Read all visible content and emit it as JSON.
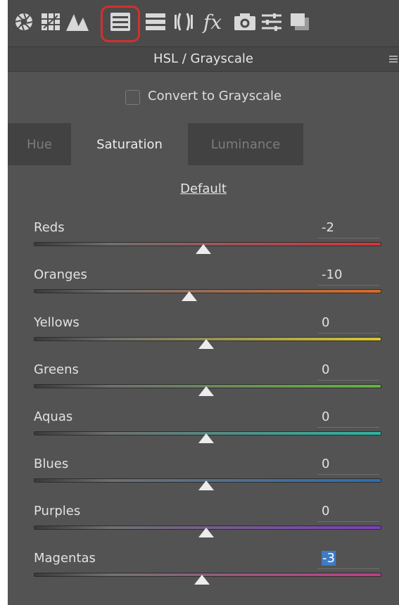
{
  "toolbar": {
    "icons": [
      "aperture-icon",
      "grid-icon",
      "mountain-icon",
      "hsl-icon",
      "split-toning-icon",
      "lens-icon",
      "fx-icon",
      "camera-icon",
      "presets-icon",
      "snapshots-icon"
    ],
    "fx_label": "fx",
    "active_icon": "hsl-icon"
  },
  "panel": {
    "title": "HSL / Grayscale"
  },
  "convert": {
    "label": "Convert to Grayscale",
    "checked": false
  },
  "tabs": [
    {
      "label": "Hue",
      "active": false
    },
    {
      "label": "Saturation",
      "active": true
    },
    {
      "label": "Luminance",
      "active": false
    }
  ],
  "default_link": "Default",
  "sliders": [
    {
      "label": "Reds",
      "value": "-2",
      "color": "#d6333a"
    },
    {
      "label": "Oranges",
      "value": "-10",
      "color": "#d86a2a"
    },
    {
      "label": "Yellows",
      "value": "0",
      "color": "#d7c82c"
    },
    {
      "label": "Greens",
      "value": "0",
      "color": "#62b33c"
    },
    {
      "label": "Aquas",
      "value": "0",
      "color": "#2fb3a0"
    },
    {
      "label": "Blues",
      "value": "0",
      "color": "#2a6fb6"
    },
    {
      "label": "Purples",
      "value": "0",
      "color": "#7a3fb6"
    },
    {
      "label": "Magentas",
      "value": "-3",
      "color": "#c23a8a"
    }
  ],
  "colors": {
    "active_outline": "#d0312d",
    "selection": "#3d7bc4",
    "panel_bg": "#535353"
  }
}
